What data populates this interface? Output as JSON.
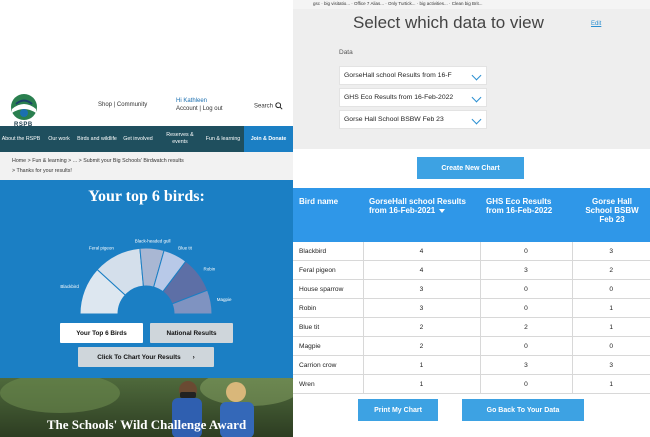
{
  "left": {
    "logo_text": "RSPB",
    "top_links": {
      "shop_community": "Shop | Community",
      "greeting": "Hi Kathleen",
      "account": "Account | Log out",
      "search": "Search"
    },
    "nav": [
      "About the RSPB",
      "Our work",
      "Birds and wildlife",
      "Get involved",
      "Reserves & events",
      "Fun & learning",
      "Join & Donate"
    ],
    "breadcrumb": {
      "items": [
        "Home",
        "Fun & learning",
        "...",
        "Submit your Big Schools' Birdwatch results"
      ],
      "sep": ">",
      "line2": "Thanks for your results!"
    },
    "top_birds_title": "Your top 6 birds:",
    "chart_data": {
      "type": "pie",
      "title": "Your top 6 birds:",
      "categories": [
        "Blackbird",
        "Feral pigeon",
        "Black-headed gull",
        "Blue tit",
        "Robin",
        "Magpie"
      ],
      "values": [
        4,
        4,
        2,
        2,
        3,
        2
      ],
      "display_labels": [
        "Blackbird",
        "Feral pigeon",
        "Black-headed gull",
        "Blue tit",
        "Robin",
        "Magpie"
      ],
      "colors": [
        "#dde7f0",
        "#d4dfeb",
        "#a9b7d3",
        "#b8c9e8",
        "#5d6fa6",
        "#7f93c1"
      ]
    },
    "buttons": {
      "top6": "Your Top 6 Birds",
      "national": "National Results",
      "chart_results": "Click To Chart Your Results"
    },
    "photo_caption": "The Schools' Wild Challenge Award"
  },
  "right": {
    "tabs_text": "gsc  ·  big visitatio...  ·  Office 7 Alias...  ·  Only Turtick...  ·  big activities...  ·  Clean big Brit...",
    "title": "Select which data to view",
    "edit": "Edit",
    "data_label": "Data",
    "selects": [
      "GorseHall school Results from 16-F",
      "GHS Eco Results from 16-Feb-2022",
      "Gorse Hall School BSBW Feb 23"
    ],
    "create_button": "Create New Chart",
    "table": {
      "headers": [
        "Bird name",
        "GorseHall school Results from 16-Feb-2021",
        "GHS Eco Results from 16-Feb-2022",
        "Gorse Hall School BSBW Feb 23"
      ],
      "rows": [
        [
          "Blackbird",
          "4",
          "0",
          "3"
        ],
        [
          "Feral pigeon",
          "4",
          "3",
          "2"
        ],
        [
          "House sparrow",
          "3",
          "0",
          "0"
        ],
        [
          "Robin",
          "3",
          "0",
          "1"
        ],
        [
          "Blue tit",
          "2",
          "2",
          "1"
        ],
        [
          "Magpie",
          "2",
          "0",
          "0"
        ],
        [
          "Carrion crow",
          "1",
          "3",
          "3"
        ],
        [
          "Wren",
          "1",
          "0",
          "1"
        ]
      ]
    },
    "print_button": "Print My Chart",
    "back_button": "Go Back To Your Data"
  }
}
